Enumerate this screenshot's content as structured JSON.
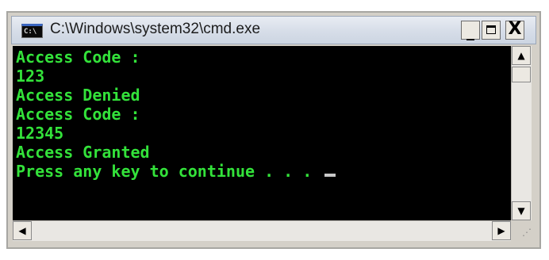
{
  "window": {
    "title": "C:\\Windows\\system32\\cmd.exe",
    "icon_label": "C:\\",
    "icon": "cmd-console-icon"
  },
  "controls": {
    "minimize": "_",
    "close": "X",
    "minimize_icon": "minimize-icon",
    "maximize_icon": "maximize-icon",
    "close_icon": "close-icon"
  },
  "console": {
    "text_color": "#33e23a",
    "background": "#000000",
    "lines": [
      "Access Code :",
      "123",
      "Access Denied",
      "Access Code :",
      "12345",
      "Access Granted",
      "Press any key to continue . . . "
    ]
  },
  "scrollbars": {
    "up_arrow": "▲",
    "down_arrow": "▼",
    "left_arrow": "◀",
    "right_arrow": "▶",
    "grip": "⋰"
  }
}
